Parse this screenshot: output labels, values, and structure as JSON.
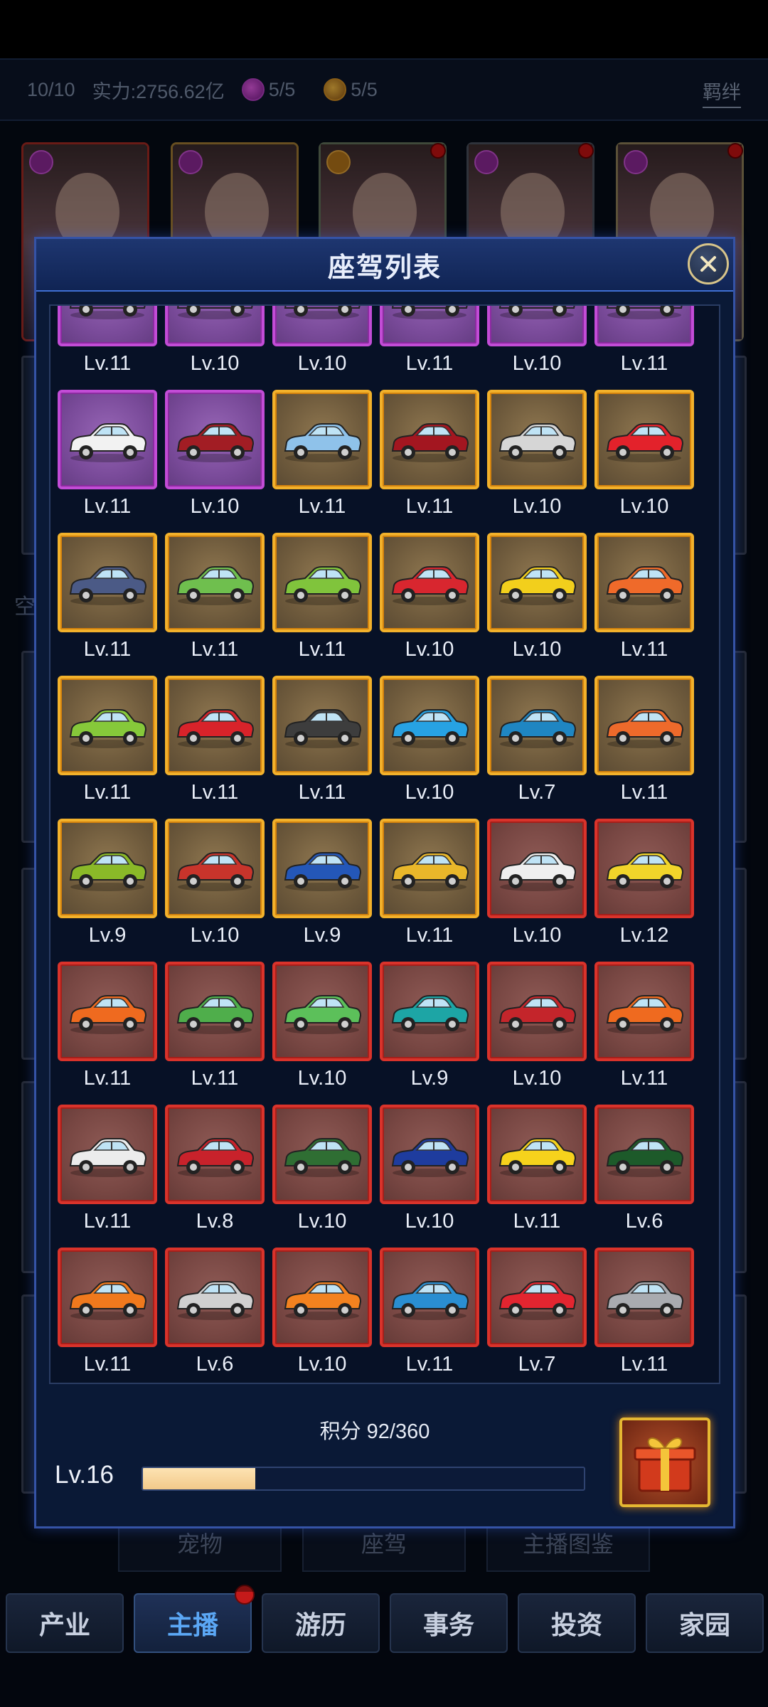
{
  "header": {
    "count": "10/10",
    "power_label": "实力:",
    "power_value": "2756.62亿",
    "purple_count": "5/5",
    "gold_count": "5/5",
    "bond_label": "羁绊"
  },
  "background": {
    "side_text": "空",
    "tabs": [
      "宠物",
      "座驾",
      "主播图鉴"
    ]
  },
  "bottom_nav": {
    "items": [
      "产业",
      "主播",
      "游历",
      "事务",
      "投资",
      "家园"
    ],
    "active_index": 1
  },
  "modal": {
    "title": "座驾列表",
    "score_text": "积分 92/360",
    "score_current": 92,
    "score_total": 360,
    "level_label": "Lv.16"
  },
  "cars": [
    {
      "level": "Lv.11",
      "tier": "purple",
      "color": "#7a4b9a"
    },
    {
      "level": "Lv.10",
      "tier": "purple",
      "color": "#7a4b9a"
    },
    {
      "level": "Lv.10",
      "tier": "purple",
      "color": "#7a4b9a"
    },
    {
      "level": "Lv.11",
      "tier": "purple",
      "color": "#7a4b9a"
    },
    {
      "level": "Lv.10",
      "tier": "purple",
      "color": "#7a4b9a"
    },
    {
      "level": "Lv.11",
      "tier": "purple",
      "color": "#7a4b9a"
    },
    {
      "level": "Lv.11",
      "tier": "purple",
      "color": "#f2f2f2"
    },
    {
      "level": "Lv.10",
      "tier": "purple",
      "color": "#a21d24"
    },
    {
      "level": "Lv.11",
      "tier": "gold",
      "color": "#8fc2ea"
    },
    {
      "level": "Lv.11",
      "tier": "gold",
      "color": "#a31620"
    },
    {
      "level": "Lv.10",
      "tier": "gold",
      "color": "#d6d6d6"
    },
    {
      "level": "Lv.10",
      "tier": "gold",
      "color": "#e3222b"
    },
    {
      "level": "Lv.11",
      "tier": "gold",
      "color": "#4b5a86"
    },
    {
      "level": "Lv.11",
      "tier": "gold",
      "color": "#6fbf4e"
    },
    {
      "level": "Lv.11",
      "tier": "gold",
      "color": "#80c43c"
    },
    {
      "level": "Lv.10",
      "tier": "gold",
      "color": "#d8262f"
    },
    {
      "level": "Lv.10",
      "tier": "gold",
      "color": "#f2cf1c"
    },
    {
      "level": "Lv.11",
      "tier": "gold",
      "color": "#ef6a2a"
    },
    {
      "level": "Lv.11",
      "tier": "gold",
      "color": "#86c93a"
    },
    {
      "level": "Lv.11",
      "tier": "gold",
      "color": "#d8232a"
    },
    {
      "level": "Lv.11",
      "tier": "gold",
      "color": "#3d3d3d"
    },
    {
      "level": "Lv.10",
      "tier": "gold",
      "color": "#27a2e3"
    },
    {
      "level": "Lv.7",
      "tier": "gold",
      "color": "#1f86c2"
    },
    {
      "level": "Lv.11",
      "tier": "gold",
      "color": "#ee6a2b"
    },
    {
      "level": "Lv.9",
      "tier": "gold",
      "color": "#8ab928"
    },
    {
      "level": "Lv.10",
      "tier": "gold",
      "color": "#c8342b"
    },
    {
      "level": "Lv.9",
      "tier": "gold",
      "color": "#2457b8"
    },
    {
      "level": "Lv.11",
      "tier": "gold",
      "color": "#e9b72a"
    },
    {
      "level": "Lv.10",
      "tier": "red",
      "color": "#efefef"
    },
    {
      "level": "Lv.12",
      "tier": "red",
      "color": "#f1d52a"
    },
    {
      "level": "Lv.11",
      "tier": "red",
      "color": "#ef6a1f"
    },
    {
      "level": "Lv.11",
      "tier": "red",
      "color": "#4fae4b"
    },
    {
      "level": "Lv.10",
      "tier": "red",
      "color": "#5cc05a"
    },
    {
      "level": "Lv.9",
      "tier": "red",
      "color": "#1da5a5"
    },
    {
      "level": "Lv.10",
      "tier": "red",
      "color": "#c4252b"
    },
    {
      "level": "Lv.11",
      "tier": "red",
      "color": "#ef6a1f"
    },
    {
      "level": "Lv.11",
      "tier": "red",
      "color": "#ececec"
    },
    {
      "level": "Lv.8",
      "tier": "red",
      "color": "#c8222b"
    },
    {
      "level": "Lv.10",
      "tier": "red",
      "color": "#2f6e33"
    },
    {
      "level": "Lv.10",
      "tier": "red",
      "color": "#1e3c9e"
    },
    {
      "level": "Lv.11",
      "tier": "red",
      "color": "#f6d21c"
    },
    {
      "level": "Lv.6",
      "tier": "red",
      "color": "#1d5a2a"
    },
    {
      "level": "Lv.11",
      "tier": "red",
      "color": "#f0791d"
    },
    {
      "level": "Lv.6",
      "tier": "red",
      "color": "#d0d0d0"
    },
    {
      "level": "Lv.10",
      "tier": "red",
      "color": "#f3821f"
    },
    {
      "level": "Lv.11",
      "tier": "red",
      "color": "#2a8ed1"
    },
    {
      "level": "Lv.7",
      "tier": "red",
      "color": "#e32530"
    },
    {
      "level": "Lv.11",
      "tier": "red",
      "color": "#a9abb0"
    }
  ]
}
